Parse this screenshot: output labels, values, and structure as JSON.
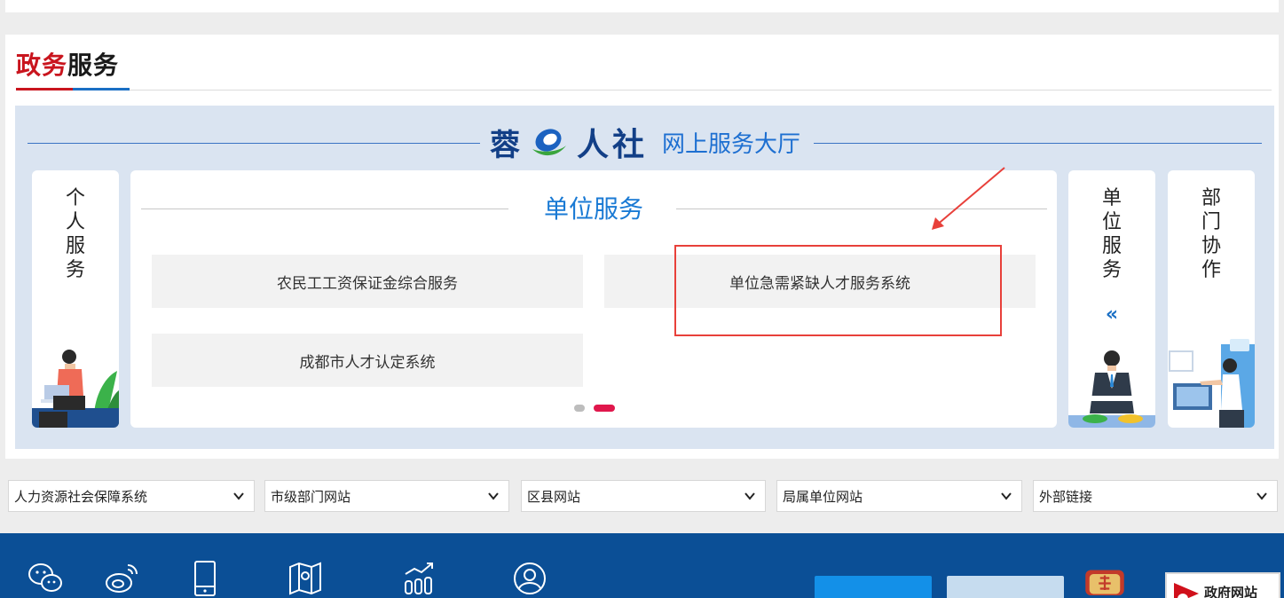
{
  "section": {
    "title_red": "政务",
    "title_dark": "服务"
  },
  "hall": {
    "logo_prefix": "蓉",
    "logo_main": "人社",
    "logo_sub": "网上服务大厅"
  },
  "side_cards": {
    "personal": {
      "chars": [
        "个",
        "人",
        "服",
        "务"
      ]
    },
    "unit": {
      "chars": [
        "单",
        "位",
        "服",
        "务"
      ],
      "chevron": "«"
    },
    "dept": {
      "chars": [
        "部",
        "门",
        "协",
        "作"
      ]
    }
  },
  "main_card": {
    "title": "单位服务",
    "services": [
      {
        "label": "农民工工资保证金综合服务"
      },
      {
        "label": "单位急需紧缺人才服务系统"
      },
      {
        "label": "成都市人才认定系统"
      }
    ],
    "pager": {
      "total": 2,
      "active": 2
    }
  },
  "colors": {
    "brand_red": "#c9151e",
    "brand_blue": "#1a6fc4",
    "active_dot": "#e0174c",
    "footer_bg": "#0b4f96",
    "annotation": "#e8403a"
  },
  "selects": [
    {
      "value": "人力资源社会保障系统"
    },
    {
      "value": "市级部门网站"
    },
    {
      "value": "区县网站"
    },
    {
      "value": "局属单位网站"
    },
    {
      "value": "外部链接"
    }
  ],
  "footer": {
    "icons": [
      "wechat-icon",
      "weibo-icon",
      "mobile-icon",
      "map-icon",
      "stats-icon",
      "user-icon"
    ],
    "gov_badge": "政府网站"
  }
}
